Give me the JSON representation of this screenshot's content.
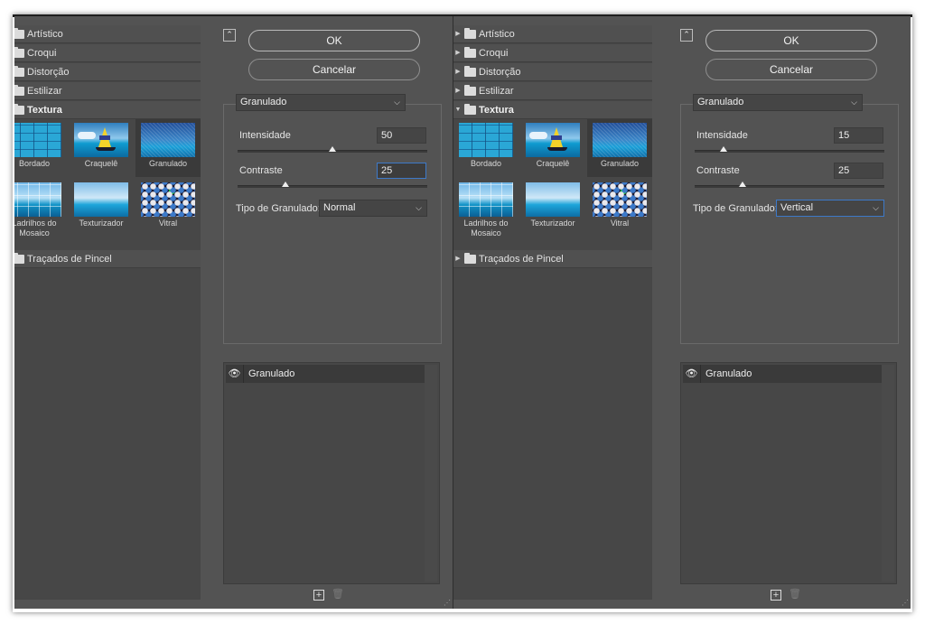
{
  "colors": {
    "dialog_bg": "#535353",
    "list_bg": "#474747",
    "focus_border": "#3d79c8"
  },
  "panels": [
    {
      "categories": [
        {
          "label": "Artístico",
          "open": false
        },
        {
          "label": "Croqui",
          "open": false
        },
        {
          "label": "Distorção",
          "open": false
        },
        {
          "label": "Estilizar",
          "open": false
        },
        {
          "label": "Textura",
          "open": true
        }
      ],
      "thumbs": [
        {
          "label": "Bordado",
          "icon": "bordado-thumbnail"
        },
        {
          "label": "Craquelê",
          "icon": "craquele-thumbnail"
        },
        {
          "label": "Granulado",
          "icon": "granulado-thumbnail",
          "selected": true
        },
        {
          "label": "Ladrilhos do Mosaico",
          "icon": "mosaic-thumbnail"
        },
        {
          "label": "Texturizador",
          "icon": "texturizador-thumbnail"
        },
        {
          "label": "Vitral",
          "icon": "vitral-thumbnail"
        }
      ],
      "last_category": "Traçados de Pincel",
      "ok_label": "OK",
      "cancel_label": "Cancelar",
      "filter_select": "Granulado",
      "intensity": {
        "label": "Intensidade",
        "value": "50",
        "max": 100
      },
      "contrast": {
        "label": "Contraste",
        "value": "25",
        "max": 100
      },
      "grain_type": {
        "label": "Tipo de Granulado:",
        "value": "Normal"
      },
      "layer": {
        "name": "Granulado"
      }
    },
    {
      "categories": [
        {
          "label": "Artístico",
          "open": false
        },
        {
          "label": "Croqui",
          "open": false
        },
        {
          "label": "Distorção",
          "open": false
        },
        {
          "label": "Estilizar",
          "open": false
        },
        {
          "label": "Textura",
          "open": true
        }
      ],
      "thumbs": [
        {
          "label": "Bordado",
          "icon": "bordado-thumbnail"
        },
        {
          "label": "Craquelê",
          "icon": "craquele-thumbnail"
        },
        {
          "label": "Granulado",
          "icon": "granulado-thumbnail",
          "selected": true
        },
        {
          "label": "Ladrilhos do Mosaico",
          "icon": "mosaic-thumbnail"
        },
        {
          "label": "Texturizador",
          "icon": "texturizador-thumbnail"
        },
        {
          "label": "Vitral",
          "icon": "vitral-thumbnail"
        }
      ],
      "last_category": "Traçados de Pincel",
      "ok_label": "OK",
      "cancel_label": "Cancelar",
      "filter_select": "Granulado",
      "intensity": {
        "label": "Intensidade",
        "value": "15",
        "max": 100
      },
      "contrast": {
        "label": "Contraste",
        "value": "25",
        "max": 100
      },
      "grain_type": {
        "label": "Tipo de Granulado:",
        "value": "Vertical"
      },
      "layer": {
        "name": "Granulado"
      }
    }
  ]
}
